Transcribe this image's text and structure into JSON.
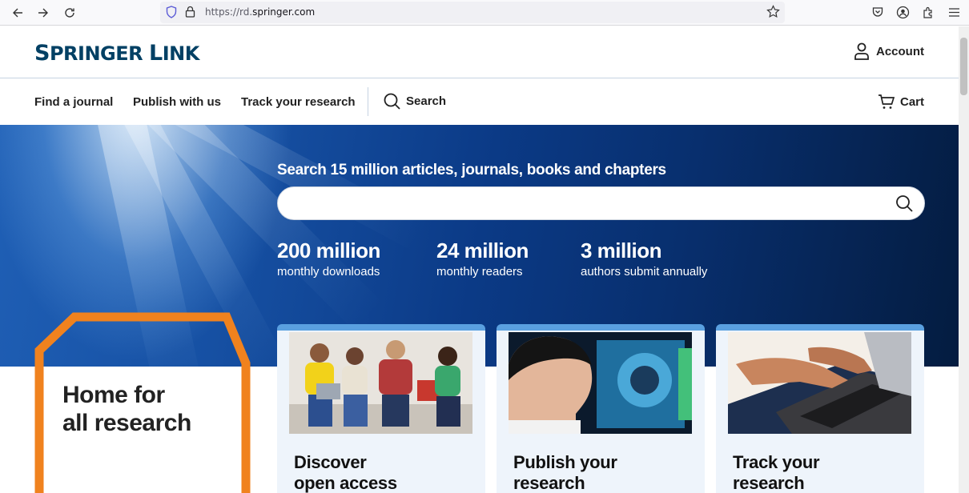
{
  "browser": {
    "url_scheme": "https://rd.",
    "url_host": "springer.com"
  },
  "header": {
    "logo_first": "S",
    "logo_rest1": "PRINGER ",
    "logo_second": "L",
    "logo_rest2": "INK",
    "account_label": "Account"
  },
  "nav": {
    "items": [
      "Find a journal",
      "Publish with us",
      "Track your research"
    ],
    "search_label": "Search",
    "cart_label": "Cart"
  },
  "hero": {
    "title": "Search 15 million articles, journals, books and chapters",
    "search_placeholder": "",
    "stats": [
      {
        "number": "200 million",
        "label": "monthly downloads"
      },
      {
        "number": "24 million",
        "label": "monthly readers"
      },
      {
        "number": "3 million",
        "label": "authors submit annually"
      }
    ]
  },
  "home": {
    "line1": "Home for",
    "line2": "all research"
  },
  "cards": [
    {
      "line1": "Discover",
      "line2": "open access"
    },
    {
      "line1": "Publish your",
      "line2": "research"
    },
    {
      "line1": "Track your",
      "line2": "research"
    }
  ],
  "colors": {
    "brand": "#024064",
    "accent_orange": "#f0821e",
    "card_top": "#5aa0e0"
  }
}
